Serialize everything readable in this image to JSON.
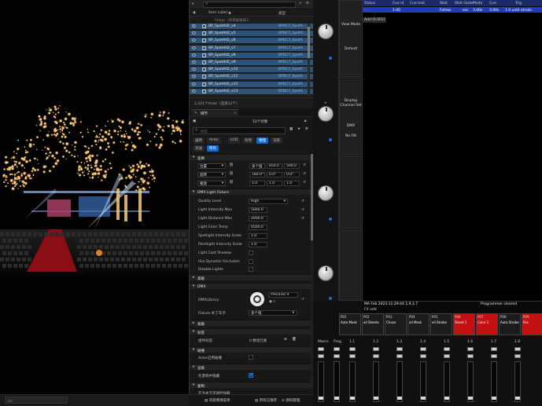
{
  "outliner": {
    "search_placeholder": "",
    "header_col1": "Item Label ▲",
    "header_col2": "类型",
    "folder_row": "Stage（场景编辑器1）",
    "items": [
      {
        "name": "BP_SpotAll2_v4",
        "type": "BPDC7_SpotA"
      },
      {
        "name": "BP_SpotAll2_v5",
        "type": "BPDC7_SpotA"
      },
      {
        "name": "BP_SpotAll2_v6",
        "type": "BPDC7_SpotA"
      },
      {
        "name": "BP_SpotAll2_v7",
        "type": "BPDC7_SpotA"
      },
      {
        "name": "BP_SpotAll2_v8",
        "type": "BPDC7_SpotA"
      },
      {
        "name": "BP_SpotAll2_v9",
        "type": "BPDC7_SpotA"
      },
      {
        "name": "BP_SpotAll2_v10",
        "type": "BPDC7_SpotA"
      },
      {
        "name": "BP_SpotAll2_v11",
        "type": "BPDC7_SpotA"
      },
      {
        "name": "BP_SpotAll2_v12",
        "type": "BPDC7_SpotA"
      },
      {
        "name": "BP_SpotAll2_v13",
        "type": "BPDC7_SpotA"
      }
    ],
    "footer": "2,321个Actor（选择12个）"
  },
  "details": {
    "tab": "细节",
    "selected_count": "12个对象",
    "search_placeholder": "搜索",
    "filters_row1": [
      "通用",
      "Actor",
      "LOD",
      "杂项",
      "物理",
      "渲染"
    ],
    "filters_row2": [
      "流送",
      "所有"
    ],
    "section_transform": "变换",
    "transform": [
      {
        "label": "位置",
        "x": "多个值",
        "y": "850.0",
        "z": "500.0"
      },
      {
        "label": "旋转",
        "x": "180.0°",
        "y": "0.0°",
        "z": "0.0°"
      },
      {
        "label": "缩放",
        "x": "1.0",
        "y": "1.0",
        "z": "1.0"
      }
    ],
    "section_dmx_light": "DMX Light Fixture",
    "props": [
      {
        "label": "Quality Level",
        "value": "High"
      },
      {
        "label": "Light Intensity Max",
        "value": "5000.0"
      },
      {
        "label": "Light Distance Max",
        "value": "2000.0"
      },
      {
        "label": "Light Color Temp",
        "value": "6500.0"
      },
      {
        "label": "Spotlight Intensity Scale",
        "value": "1.0"
      },
      {
        "label": "Pointlight Intensity Scale",
        "value": "1.0"
      }
    ],
    "checks": [
      "Light Cast Shadow",
      "Use Dynamic Occlusion",
      "Disable Lights"
    ],
    "section_sub": "高级",
    "section_dmx": "DMX",
    "dmx_library_label": "DMXLibrary",
    "dmx_library_value": "ProcoTec",
    "fixture_patch_label": "Fixture 补丁车子",
    "fixture_patch_value": "多个值",
    "section_misc": "高级",
    "section_tags": "标签",
    "tags_label": "组件标签",
    "tags_value": "0 数组元素",
    "section_collision": "碰撞",
    "collision_label": "Actor启用碰撞",
    "section_render": "渲染",
    "render_label": "在游戏中隐藏",
    "section_replication": "复制",
    "replication_label": "在为关卡流送时加载"
  },
  "bottom_bar": {
    "content_drawer": "内容侧滑菜单",
    "output_log": "输出日志",
    "cmd": "Cmd",
    "all_saved": "所有已保存",
    "revision": "源码管理"
  },
  "console": {
    "side_buttons": [
      "View Mode",
      "Default",
      "Display Channel Set",
      "DMX",
      "No Filt"
    ],
    "sheet_headers": [
      "Status",
      "Cue id",
      "Cue text",
      "Wait",
      "Wait Outer",
      "Mode",
      "Cue",
      "Trig"
    ],
    "sheet_row": [
      "-",
      "1.00",
      "",
      "",
      "Follow",
      "sec",
      "3.00s",
      "3.00s",
      "1.0 until stroke"
    ],
    "sheet_subrow": "Add (0.001)",
    "status_line": "MA Feb 2023 11:29:44 1.9.3.7",
    "status_line2": "FX add",
    "programmer": "Programmer cleared",
    "executors": [
      {
        "label": "P01",
        "text": "Auto Mask",
        "red": false
      },
      {
        "label": "P02",
        "text": "all Sheets",
        "red": false
      },
      {
        "label": "P03",
        "text": "Chase",
        "red": false
      },
      {
        "label": "P04",
        "text": "all Mask",
        "red": false
      },
      {
        "label": "P05",
        "text": "all Strobe",
        "red": false
      },
      {
        "label": "P06",
        "text": "Sheet 1",
        "red": true
      },
      {
        "label": "P07",
        "text": "Color 1",
        "red": true
      },
      {
        "label": "P08",
        "text": "Auto Strobe",
        "red": false
      },
      {
        "label": "P09",
        "text": "Pos",
        "red": true
      }
    ],
    "fader_labels": [
      "Macro",
      "Prog",
      "1.1",
      "1.2",
      "1.3",
      "1.4",
      "1.5",
      "1.6",
      "1.7",
      "1.8"
    ]
  },
  "colors": {
    "accent": "#0b6bd6",
    "selection": "#2e5378",
    "exec_red": "#c41010",
    "bg": "#0c0c0c"
  }
}
